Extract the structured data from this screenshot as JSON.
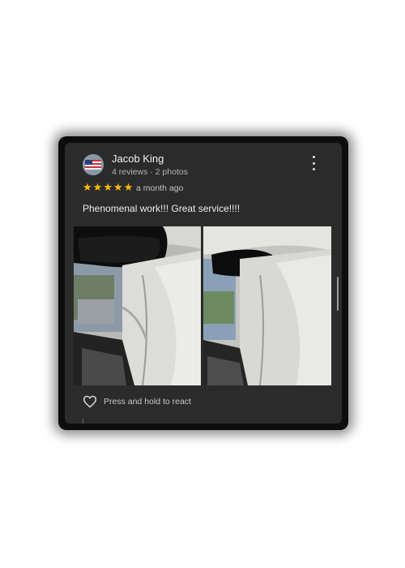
{
  "review": {
    "author": "Jacob King",
    "author_meta": "4 reviews · 2 photos",
    "rating": 5,
    "time_ago": "a month ago",
    "comment": "Phenomenal work!!! Great service!!!!",
    "react_label": "Press and hold to react",
    "photos": [
      "photo-1",
      "photo-2"
    ]
  },
  "icons": {
    "more": "more-vert-icon",
    "heart": "heart-outline-icon",
    "star": "star-icon"
  },
  "colors": {
    "card_bg": "#2b2b2b",
    "star": "#fbbc04",
    "text_primary": "#f2f2f2",
    "text_secondary": "#b3b3b3"
  }
}
